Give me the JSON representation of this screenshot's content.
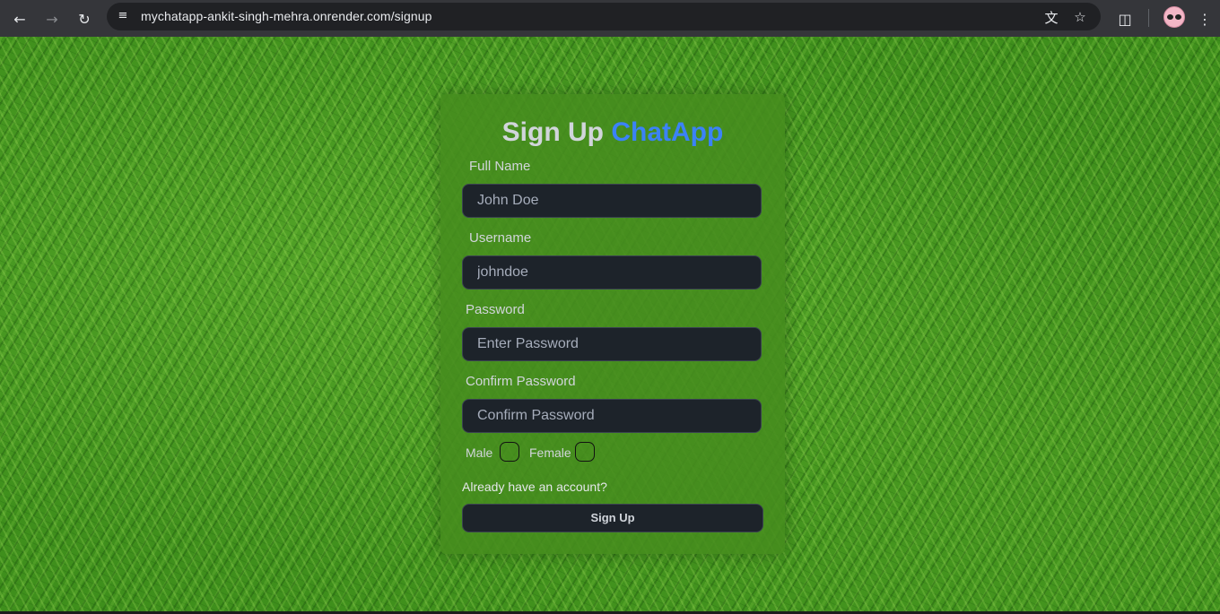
{
  "browser": {
    "url": "mychatapp-ankit-singh-mehra.onrender.com/signup",
    "icons": {
      "back": "arrow-left-icon",
      "forward": "arrow-right-icon",
      "reload": "reload-icon",
      "site_info": "tune-icon",
      "translate": "translate-icon",
      "bookmark": "star-icon",
      "extensions": "puzzle-icon",
      "profile": "avatar",
      "menu": "kebab-menu-icon"
    }
  },
  "signup": {
    "title_prefix": "Sign Up",
    "title_brand": "ChatApp",
    "brand_color": "#3b82f6",
    "fields": {
      "full_name": {
        "label": "Full Name",
        "placeholder": "John Doe"
      },
      "username": {
        "label": "Username",
        "placeholder": "johndoe"
      },
      "password": {
        "label": "Password",
        "placeholder": "Enter Password"
      },
      "confirm_password": {
        "label": "Confirm Password",
        "placeholder": "Confirm Password"
      }
    },
    "gender": {
      "male_label": "Male",
      "female_label": "Female"
    },
    "login_link": "Already have an account?",
    "submit_label": "Sign Up"
  }
}
